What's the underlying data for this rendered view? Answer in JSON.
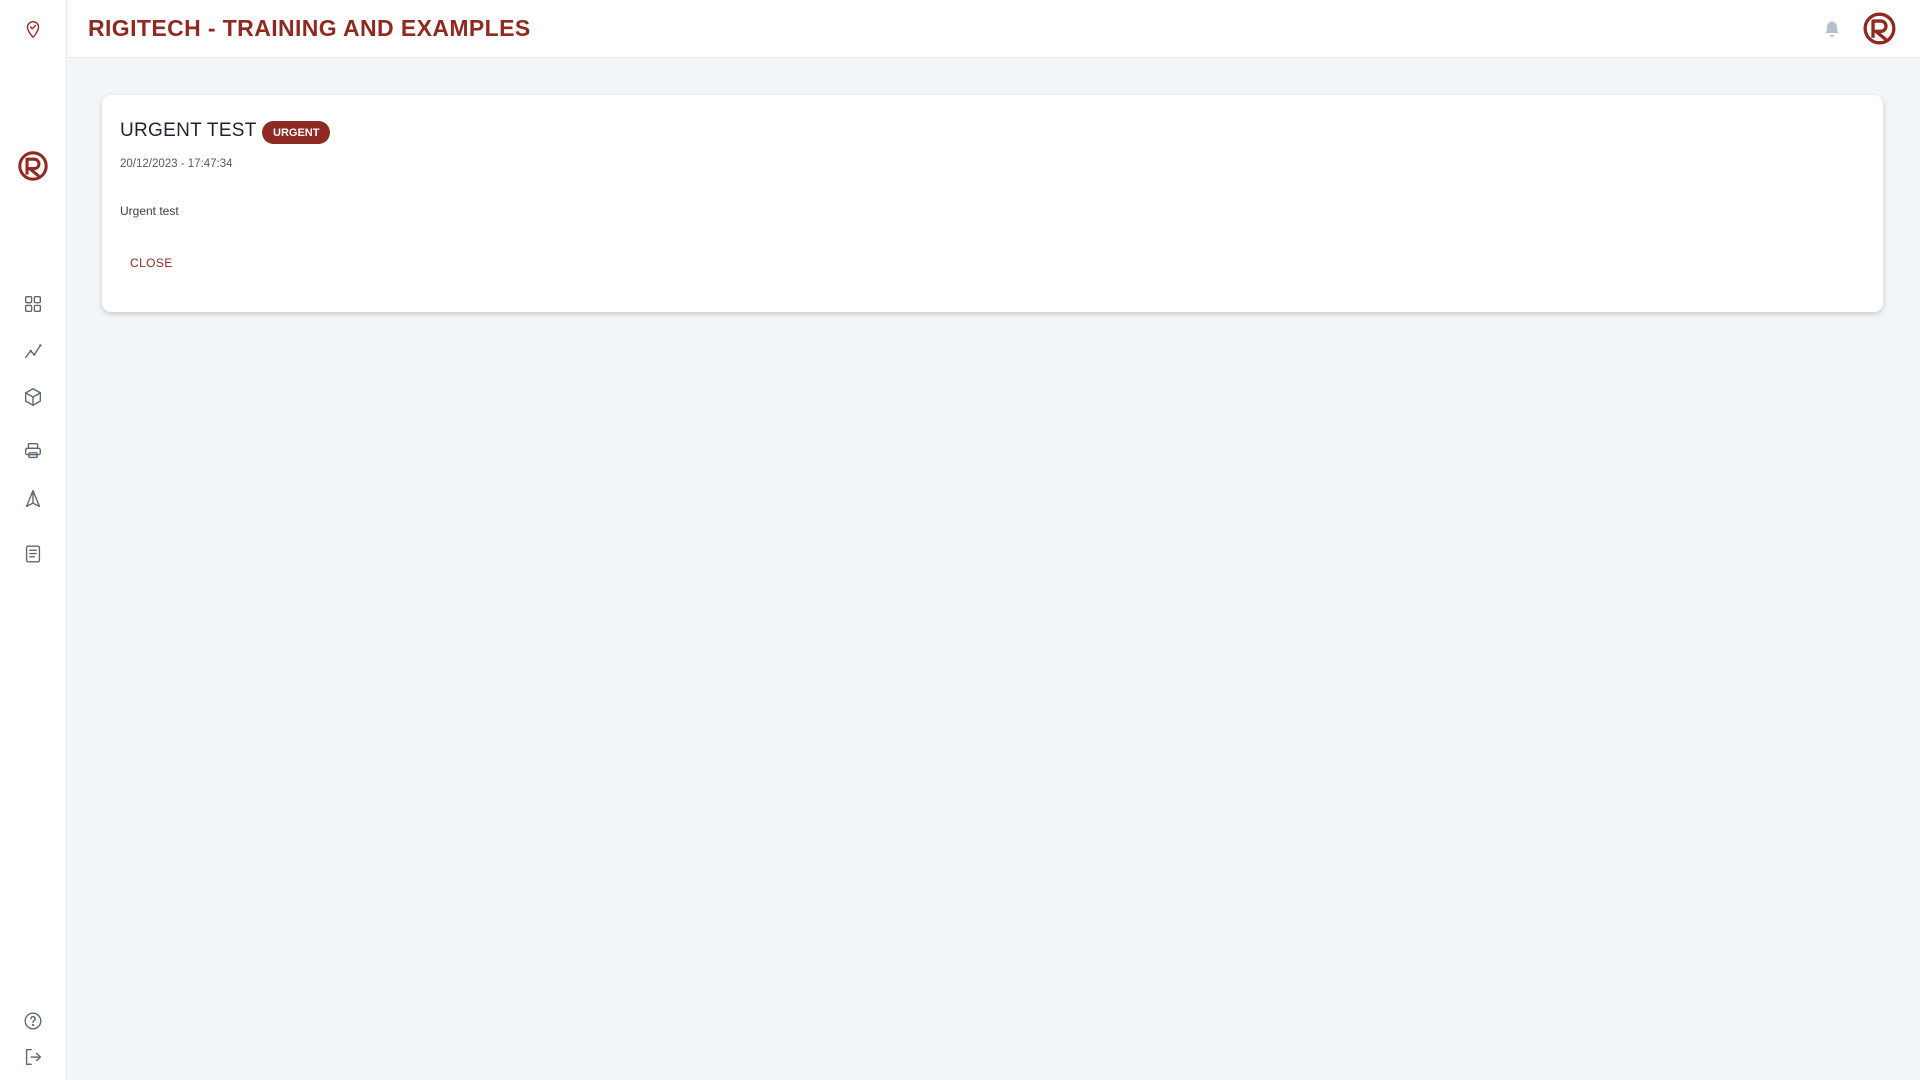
{
  "header": {
    "title": "RIGITECH - TRAINING AND EXAMPLES",
    "notification_icon": "bell-icon",
    "logo_icon": "rigitech-logo"
  },
  "sidebar": {
    "top_icon": "location-check-icon",
    "logo_icon": "rigitech-logo",
    "items": [
      {
        "icon": "dashboard-grid-icon"
      },
      {
        "icon": "line-chart-icon"
      },
      {
        "icon": "box-icon"
      },
      {
        "icon": "printer-icon"
      },
      {
        "icon": "navigation-icon"
      },
      {
        "icon": "document-icon"
      }
    ],
    "bottom_items": [
      {
        "icon": "help-icon"
      },
      {
        "icon": "logout-icon"
      }
    ]
  },
  "notification": {
    "title": "URGENT TEST",
    "badge": "URGENT",
    "date": "20/12/2023 - 17:47:34",
    "message": "Urgent test",
    "close_label": "CLOSE"
  },
  "colors": {
    "brand": "#8e2a22",
    "background": "#f2f6f9",
    "surface": "#ffffff",
    "icon": "#5f6773"
  }
}
